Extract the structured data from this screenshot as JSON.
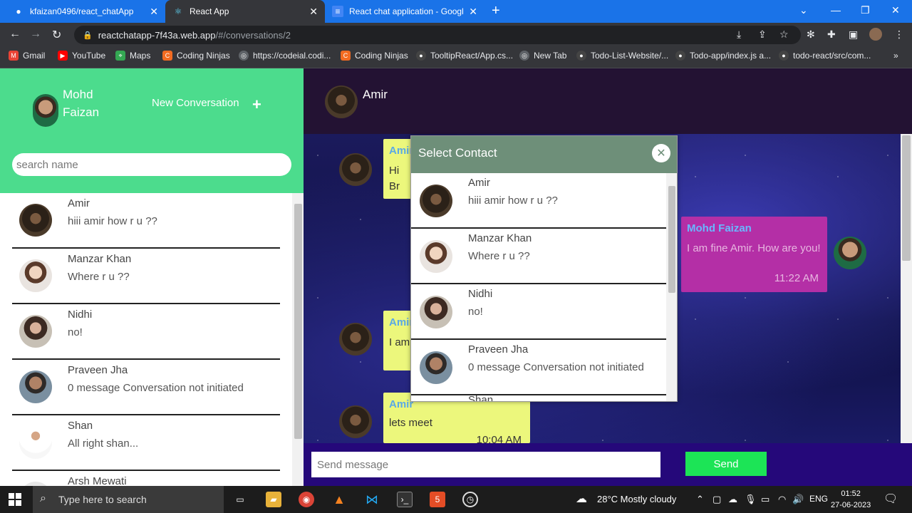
{
  "browser": {
    "tabs": [
      {
        "label": "kfaizan0496/react_chatApp",
        "icon": "github-icon"
      },
      {
        "label": "React App",
        "icon": "react-icon",
        "active": true
      },
      {
        "label": "React chat application - Google D",
        "icon": "google-docs-icon"
      }
    ],
    "url_host": "reactchatapp-7f43a.web.app",
    "url_path": "/#/conversations/2",
    "bookmarks": [
      {
        "label": "Gmail",
        "color": "#ea4335"
      },
      {
        "label": "YouTube",
        "color": "#ff0000"
      },
      {
        "label": "Maps",
        "color": "#34a853"
      },
      {
        "label": "Coding Ninjas",
        "color": "#f26b21"
      },
      {
        "label": "https://codeial.codi...",
        "color": "#5f6368"
      },
      {
        "label": "Coding Ninjas",
        "color": "#f26b21"
      },
      {
        "label": "TooltipReact/App.cs...",
        "color": "#444444"
      },
      {
        "label": "New Tab",
        "color": "#5f6368"
      },
      {
        "label": "Todo-List-Website/...",
        "color": "#444444"
      },
      {
        "label": "Todo-app/index.js a...",
        "color": "#444444"
      },
      {
        "label": "todo-react/src/com...",
        "color": "#444444"
      }
    ],
    "overflow": "»"
  },
  "sidebar": {
    "user_name": "Mohd Faizan",
    "new_conversation": "New Conversation",
    "plus": "+",
    "search_placeholder": "search name",
    "conversations": [
      {
        "name": "Amir",
        "message": "hiii amir how r u ??"
      },
      {
        "name": "Manzar Khan",
        "message": "Where r u ??"
      },
      {
        "name": "Nidhi",
        "message": "no!"
      },
      {
        "name": "Praveen Jha",
        "message": "0 message Conversation not initiated"
      },
      {
        "name": "Shan",
        "message": "All right shan..."
      },
      {
        "name": "Arsh Mewati",
        "message": ""
      }
    ]
  },
  "chat": {
    "contact_name": "Amir",
    "messages": [
      {
        "sender": "Amir",
        "text": "Hi Br"
      },
      {
        "sender": "Mohd Faizan",
        "text": "I am fine Amir. How are you!",
        "time": "11:22 AM"
      },
      {
        "sender": "Amir",
        "text": "I am"
      },
      {
        "sender": "Amir",
        "text": "lets meet",
        "time": "10:04 AM"
      }
    ],
    "input_placeholder": "Send message",
    "send_label": "Send"
  },
  "modal": {
    "title": "Select Contact",
    "close": "✕",
    "contacts": [
      {
        "name": "Amir",
        "message": "hiii amir how r u ??"
      },
      {
        "name": "Manzar Khan",
        "message": "Where r u ??"
      },
      {
        "name": "Nidhi",
        "message": "no!"
      },
      {
        "name": "Praveen Jha",
        "message": "0 message Conversation not initiated"
      },
      {
        "name": "Shan",
        "message": ""
      }
    ]
  },
  "taskbar": {
    "search_placeholder": "Type here to search",
    "weather": "28°C  Mostly cloudy",
    "language": "ENG",
    "time": "01:52",
    "date": "27-06-2023"
  },
  "colors": {
    "sidebar_header": "#4cdc8d",
    "chat_header": "#231233",
    "received_bubble": "#ecf77c",
    "sent_bubble": "#b42fa6",
    "send_button": "#1ce456",
    "modal_header": "#6e8f79"
  }
}
